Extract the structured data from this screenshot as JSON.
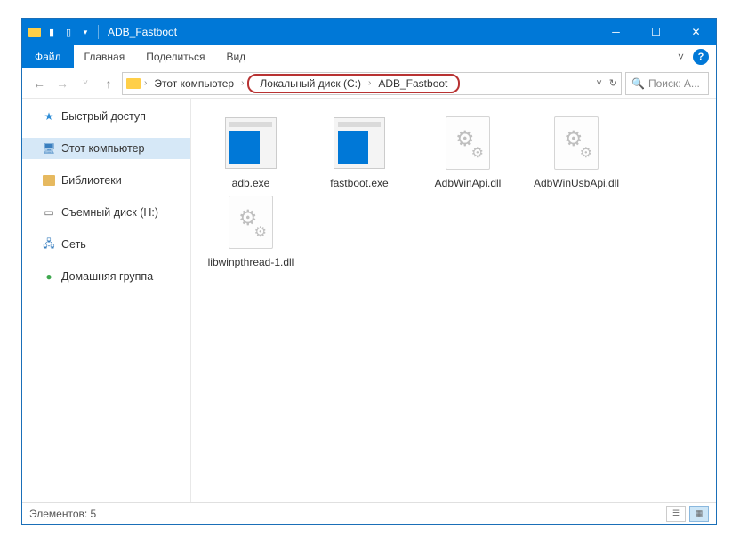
{
  "titlebar": {
    "title": "ADB_Fastboot"
  },
  "wincontrols": {
    "min": "─",
    "max": "☐",
    "close": "✕"
  },
  "ribbon": {
    "file": "Файл",
    "tabs": [
      "Главная",
      "Поделиться",
      "Вид"
    ],
    "expand": "˅",
    "help": "?"
  },
  "nav": {
    "back": "←",
    "forward": "→",
    "dropdown": "˅",
    "up": "↑",
    "root": "Этот компьютер",
    "crumb1": "Локальный диск (C:)",
    "crumb2": "ADB_Fastboot",
    "sep": "›",
    "history": "˅",
    "refresh": "↻",
    "search_placeholder": "Поиск: A...",
    "search_icon": "🔍"
  },
  "sidebar": {
    "items": [
      {
        "icon": "star",
        "label": "Быстрый доступ"
      },
      {
        "icon": "pc",
        "label": "Этот компьютер",
        "selected": true
      },
      {
        "icon": "lib",
        "label": "Библиотеки"
      },
      {
        "icon": "drive",
        "label": "Съемный диск (H:)"
      },
      {
        "icon": "net",
        "label": "Сеть"
      },
      {
        "icon": "home",
        "label": "Домашняя группа"
      }
    ]
  },
  "files": [
    {
      "type": "exe",
      "label": "adb.exe"
    },
    {
      "type": "exe",
      "label": "fastboot.exe"
    },
    {
      "type": "dll",
      "label": "AdbWinApi.dll"
    },
    {
      "type": "dll",
      "label": "AdbWinUsbApi.dll"
    },
    {
      "type": "dll",
      "label": "libwinpthread-1.dll"
    }
  ],
  "status": {
    "text": "Элементов: 5"
  }
}
